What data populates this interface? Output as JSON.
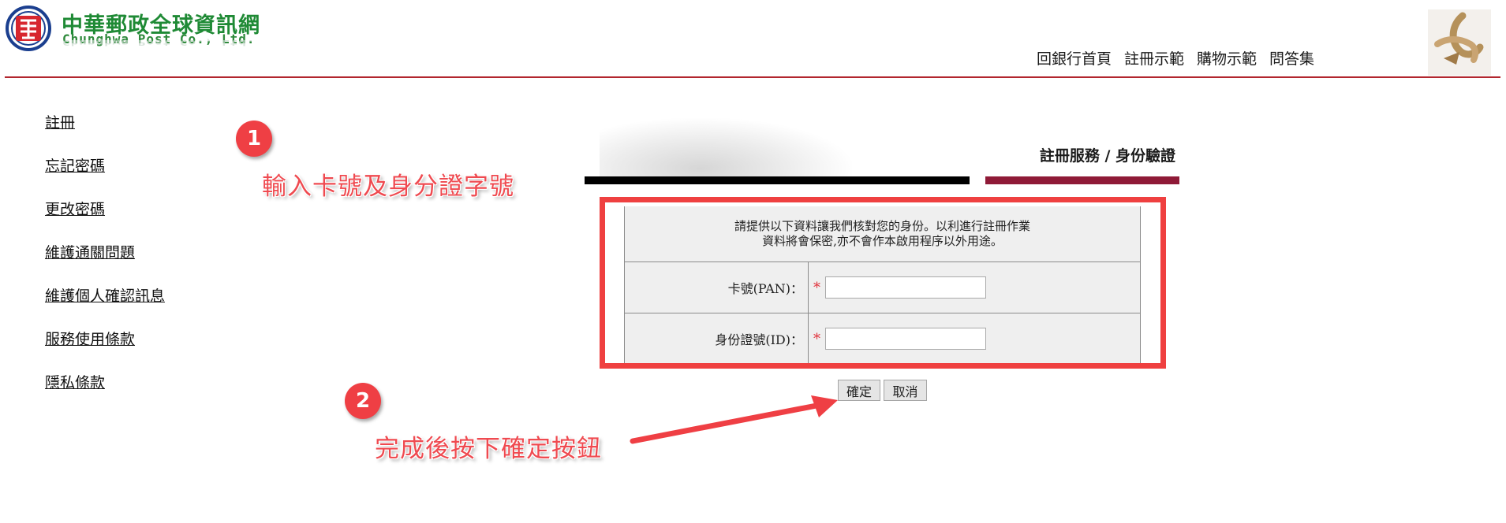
{
  "header": {
    "logo_cn": "中華郵政全球資訊網",
    "logo_en": "Chunghwa Post Co., Ltd.",
    "logo_emblem_icon": "post-emblem-icon",
    "nav": [
      "回銀行首頁",
      "註冊示範",
      "購物示範",
      "問答集"
    ],
    "accent": "#b2262e"
  },
  "sidebar": {
    "items": [
      {
        "label": "註冊"
      },
      {
        "label": "忘記密碼"
      },
      {
        "label": "更改密碼"
      },
      {
        "label": "維護通關問題"
      },
      {
        "label": "維護個人確認訊息"
      },
      {
        "label": "服務使用條款"
      },
      {
        "label": "隱私條款"
      }
    ]
  },
  "main": {
    "section_title": "註冊服務 / 身份驗證",
    "intro_line1": "請提供以下資料讓我們核對您的身份。以利進行註冊作業",
    "intro_line2": "資料將會保密,亦不會作本啟用程序以外用途。",
    "fields": [
      {
        "label": "卡號(PAN)：",
        "required_mark": "*",
        "value": ""
      },
      {
        "label": "身份證號(ID)：",
        "required_mark": "*",
        "value": ""
      }
    ],
    "confirm_label": "確定",
    "cancel_label": "取消"
  },
  "annotations": {
    "step1_number": "1",
    "step1_text": "輸入卡號及身分證字號",
    "step2_number": "2",
    "step2_text": "完成後按下確定按鈕",
    "highlight_color": "#ef4040"
  }
}
